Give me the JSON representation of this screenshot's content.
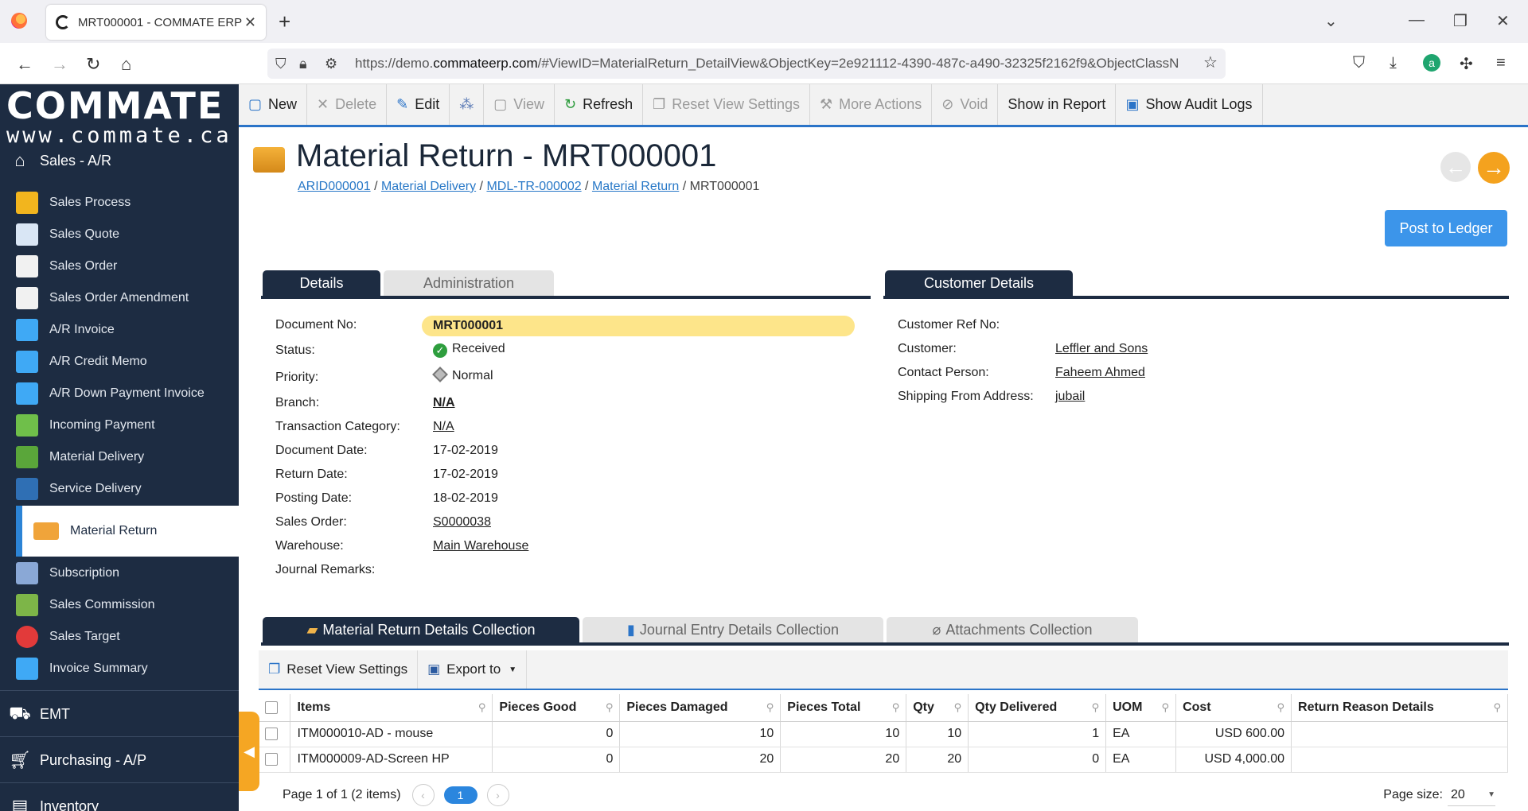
{
  "browser": {
    "tab_title": "MRT000001 - COMMATE ERP",
    "new_tab": "+",
    "url_prefix": "https://demo.",
    "url_host": "commateerp.com",
    "url_rest": "/#ViewID=MaterialReturn_DetailView&ObjectKey=2e921112-4390-487c-a490-32325f2162f9&ObjectClassN"
  },
  "sidebar": {
    "brand": "COMMATE",
    "www": "www.commate.ca",
    "group_sales": "Sales - A/R",
    "items": [
      {
        "label": "Sales Process",
        "color": "#f2b51e"
      },
      {
        "label": "Sales Quote",
        "color": "#d9e6f5"
      },
      {
        "label": "Sales Order",
        "color": "#f1f1f1"
      },
      {
        "label": "Sales Order Amendment",
        "color": "#f1f1f1"
      },
      {
        "label": "A/R Invoice",
        "color": "#3fa9f5"
      },
      {
        "label": "A/R Credit Memo",
        "color": "#3fa9f5"
      },
      {
        "label": "A/R Down Payment Invoice",
        "color": "#3fa9f5"
      },
      {
        "label": "Incoming Payment",
        "color": "#6fbf4a"
      },
      {
        "label": "Material Delivery",
        "color": "#5aa63a"
      },
      {
        "label": "Service Delivery",
        "color": "#2f6fb4"
      },
      {
        "label": "Material Return",
        "color": "#f0a43a"
      },
      {
        "label": "Subscription",
        "color": "#8aa8d6"
      },
      {
        "label": "Sales Commission",
        "color": "#7db548"
      },
      {
        "label": "Sales Target",
        "color": "#e23a3a"
      },
      {
        "label": "Invoice Summary",
        "color": "#3fa9f5"
      }
    ],
    "group_emt": "EMT",
    "group_purchasing": "Purchasing - A/P",
    "group_inventory": "Inventory"
  },
  "toolbar": {
    "new": "New",
    "delete": "Delete",
    "edit": "Edit",
    "view": "View",
    "refresh": "Refresh",
    "reset_view": "Reset View Settings",
    "more_actions": "More Actions",
    "void": "Void",
    "show_in_report": "Show in Report",
    "show_audit_logs": "Show Audit Logs"
  },
  "header": {
    "title": "Material Return - MRT000001",
    "breadcrumb": [
      "ARID000001",
      "Material Delivery",
      "MDL-TR-000002",
      "Material Return",
      "MRT000001"
    ],
    "post_button": "Post to Ledger"
  },
  "tabs": {
    "details": "Details",
    "administration": "Administration",
    "customer_details": "Customer Details"
  },
  "details": {
    "document_no_label": "Document No:",
    "document_no": "MRT000001",
    "status_label": "Status:",
    "status": "Received",
    "priority_label": "Priority:",
    "priority": "Normal",
    "branch_label": "Branch:",
    "branch": "N/A",
    "transaction_category_label": "Transaction Category:",
    "transaction_category": "N/A",
    "document_date_label": "Document Date:",
    "document_date": "17-02-2019",
    "return_date_label": "Return Date:",
    "return_date": "17-02-2019",
    "posting_date_label": "Posting Date:",
    "posting_date": "18-02-2019",
    "sales_order_label": "Sales Order:",
    "sales_order": "S0000038",
    "warehouse_label": "Warehouse:",
    "warehouse": "Main Warehouse",
    "journal_remarks_label": "Journal Remarks:"
  },
  "customer": {
    "ref_no_label": "Customer Ref No:",
    "customer_label": "Customer:",
    "customer": "Leffler and Sons",
    "contact_label": "Contact Person:",
    "contact": "Faheem Ahmed",
    "shipping_label": "Shipping From Address:",
    "shipping": "jubail"
  },
  "collections": {
    "material": "Material Return Details Collection",
    "journal": "Journal Entry Details Collection",
    "attachments": "Attachments Collection"
  },
  "grid": {
    "reset_view": "Reset View Settings",
    "export_to": "Export to",
    "columns": [
      "Items",
      "Pieces Good",
      "Pieces Damaged",
      "Pieces Total",
      "Qty",
      "Qty Delivered",
      "UOM",
      "Cost",
      "Return Reason Details"
    ],
    "rows": [
      {
        "item": "ITM000010-AD - mouse",
        "good": "0",
        "damaged": "10",
        "total": "10",
        "qty": "10",
        "delivered": "1",
        "uom": "EA",
        "cost": "USD 600.00",
        "reason": ""
      },
      {
        "item": "ITM000009-AD-Screen HP",
        "good": "0",
        "damaged": "20",
        "total": "20",
        "qty": "20",
        "delivered": "0",
        "uom": "EA",
        "cost": "USD 4,000.00",
        "reason": ""
      }
    ],
    "page_info": "Page 1 of 1 (2 items)",
    "current_page": "1",
    "page_size_label": "Page size:",
    "page_size": "20"
  }
}
